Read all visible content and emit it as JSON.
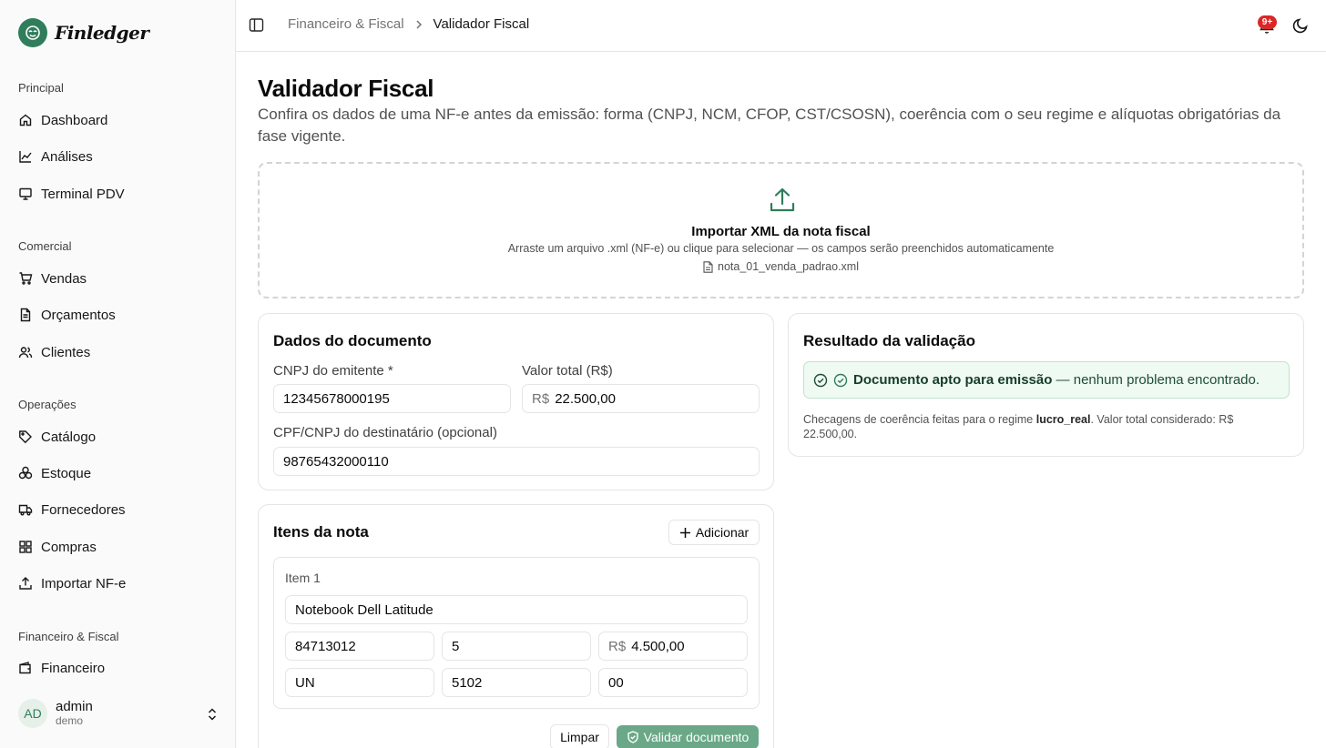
{
  "brand": {
    "name": "Finledger"
  },
  "sidebar": {
    "groups": [
      {
        "label": "Principal",
        "items": [
          {
            "label": "Dashboard",
            "icon": "home-icon"
          },
          {
            "label": "Análises",
            "icon": "chart-line-icon"
          },
          {
            "label": "Terminal PDV",
            "icon": "monitor-icon"
          }
        ]
      },
      {
        "label": "Comercial",
        "items": [
          {
            "label": "Vendas",
            "icon": "cart-icon"
          },
          {
            "label": "Orçamentos",
            "icon": "file-text-icon"
          },
          {
            "label": "Clientes",
            "icon": "users-icon"
          }
        ]
      },
      {
        "label": "Operações",
        "items": [
          {
            "label": "Catálogo",
            "icon": "tag-icon"
          },
          {
            "label": "Estoque",
            "icon": "boxes-icon"
          },
          {
            "label": "Fornecedores",
            "icon": "truck-icon"
          },
          {
            "label": "Compras",
            "icon": "grid-icon"
          },
          {
            "label": "Importar NF-e",
            "icon": "upload-icon"
          }
        ]
      },
      {
        "label": "Financeiro & Fiscal",
        "items": [
          {
            "label": "Financeiro",
            "icon": "wallet-icon"
          }
        ]
      }
    ],
    "user": {
      "initials": "AD",
      "name": "admin",
      "role": "demo"
    }
  },
  "header": {
    "breadcrumb": {
      "parent": "Financeiro & Fiscal",
      "current": "Validador Fiscal"
    },
    "notifications_badge": "9+"
  },
  "page": {
    "title": "Validador Fiscal",
    "description": "Confira os dados de uma NF-e antes da emissão: forma (CNPJ, NCM, CFOP, CST/CSOSN), coerência com o seu regime e alíquotas obrigatórias da fase vigente."
  },
  "dropzone": {
    "title": "Importar XML da nota fiscal",
    "hint": "Arraste um arquivo .xml (NF-e) ou clique para selecionar — os campos serão preenchidos automaticamente",
    "file_name": "nota_01_venda_padrao.xml"
  },
  "document": {
    "title": "Dados do documento",
    "cnpj_label": "CNPJ do emitente *",
    "cnpj_value": "12345678000195",
    "total_label": "Valor total (R$)",
    "currency_prefix": "R$",
    "total_value": "22.500,00",
    "dest_label": "CPF/CNPJ do destinatário (opcional)",
    "dest_value": "98765432000110"
  },
  "items": {
    "title": "Itens da nota",
    "add_label": "Adicionar",
    "list": [
      {
        "label": "Item 1",
        "description": "Notebook Dell Latitude",
        "ncm": "84713012",
        "quantity": "5",
        "currency_prefix": "R$",
        "unit_price": "4.500,00",
        "unit": "UN",
        "cfop": "5102",
        "cst": "00"
      }
    ],
    "clear_label": "Limpar",
    "validate_label": "Validar documento"
  },
  "result": {
    "title": "Resultado da validação",
    "status_strong": "Documento apto para emissão",
    "status_rest": " — nenhum problema encontrado.",
    "note_prefix": "Checagens de coerência feitas para o regime ",
    "regime": "lucro_real",
    "note_suffix": ". Valor total considerado: R$ 22.500,00."
  },
  "colors": {
    "brand": "#2f7d5b",
    "success_bg": "#effaf3",
    "success_border": "#bfe3cc",
    "badge": "#dc2626",
    "primary_button": "#6aa888"
  }
}
